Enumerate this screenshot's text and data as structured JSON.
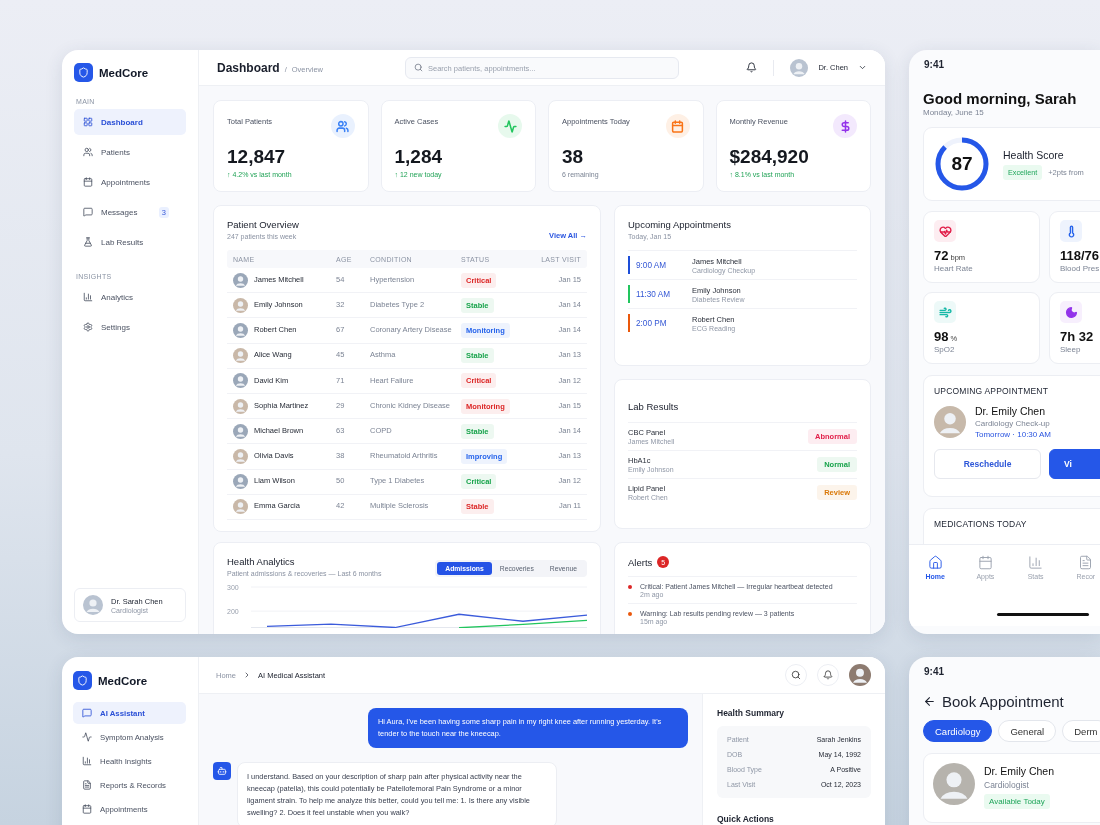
{
  "dashboard": {
    "brand": "MedCore",
    "nav_sections": [
      {
        "heading": "MAIN",
        "items": [
          {
            "label": "Dashboard",
            "selected": true
          },
          {
            "label": "Patients",
            "selected": false
          },
          {
            "label": "Appointments",
            "selected": false
          },
          {
            "label": "Messages",
            "selected": false,
            "badge": "3"
          },
          {
            "label": "Lab Results",
            "selected": false
          }
        ]
      },
      {
        "heading": "INSIGHTS",
        "items": [
          {
            "label": "Analytics",
            "selected": false
          },
          {
            "label": "Settings",
            "selected": false
          }
        ]
      }
    ],
    "user": {
      "name": "Dr. Sarah Chen",
      "role": "Cardiologist"
    },
    "title": "Dashboard",
    "crumb_separator": "/",
    "crumb": "Overview",
    "search_placeholder": "Search patients, appointments...",
    "account": "Dr. Chen",
    "stats": [
      {
        "label": "Total Patients",
        "value": "12,847",
        "note": "↑ 4.2% vs last month",
        "positive": true,
        "color": "#3b82f6"
      },
      {
        "label": "Active Cases",
        "value": "1,284",
        "note": "↑ 12 new today",
        "positive": true,
        "color": "#22c55e"
      },
      {
        "label": "Appointments Today",
        "value": "38",
        "note": "6 remaining",
        "positive": false,
        "color": "#f97316"
      },
      {
        "label": "Monthly Revenue",
        "value": "$284,920",
        "note": "↑ 8.1% vs last month",
        "positive": true,
        "color": "#9333ea"
      }
    ],
    "patients": {
      "title": "Patient Overview",
      "subtitle": "247 patients this week",
      "link": "View All →",
      "columns": [
        "NAME",
        "AGE",
        "CONDITION",
        "STATUS",
        "LAST VISIT"
      ],
      "rows": [
        {
          "name": "James Mitchell",
          "age": "54",
          "condition": "Hypertension",
          "status": "Critical",
          "color": "#dc2626",
          "last_visit": "Jan 15"
        },
        {
          "name": "Emily Johnson",
          "age": "32",
          "condition": "Diabetes Type 2",
          "status": "Stable",
          "color": "#16a34a",
          "last_visit": "Jan 14"
        },
        {
          "name": "Robert Chen",
          "age": "67",
          "condition": "Coronary Artery Disease",
          "status": "Monitoring",
          "color": "#2563eb",
          "last_visit": "Jan 14"
        },
        {
          "name": "Alice Wang",
          "age": "45",
          "condition": "Asthma",
          "status": "Stable",
          "color": "#16a34a",
          "last_visit": "Jan 13"
        },
        {
          "name": "David Kim",
          "age": "71",
          "condition": "Heart Failure",
          "status": "Critical",
          "color": "#dc2626",
          "last_visit": "Jan 12"
        },
        {
          "name": "Sophia Martinez",
          "age": "29",
          "condition": "Chronic Kidney Disease",
          "status": "Monitoring",
          "color": "#dc2626",
          "last_visit": "Jan 15"
        },
        {
          "name": "Michael Brown",
          "age": "63",
          "condition": "COPD",
          "status": "Stable",
          "color": "#16a34a",
          "last_visit": "Jan 14"
        },
        {
          "name": "Olivia Davis",
          "age": "38",
          "condition": "Rheumatoid Arthritis",
          "status": "Improving",
          "color": "#2563eb",
          "last_visit": "Jan 13"
        },
        {
          "name": "Liam Wilson",
          "age": "50",
          "condition": "Type 1 Diabetes",
          "status": "Critical",
          "color": "#16a34a",
          "last_visit": "Jan 12"
        },
        {
          "name": "Emma Garcia",
          "age": "42",
          "condition": "Multiple Sclerosis",
          "status": "Stable",
          "color": "#dc2626",
          "last_visit": "Jan 11"
        }
      ]
    },
    "appointments": {
      "title": "Upcoming Appointments",
      "subtitle": "Today, Jan 15",
      "items": [
        {
          "time": "9:00 AM",
          "name": "James Mitchell",
          "type": "Cardiology Checkup",
          "color": "#1d4ed8"
        },
        {
          "time": "11:30 AM",
          "name": "Emily Johnson",
          "type": "Diabetes Review",
          "color": "#22c55e"
        },
        {
          "time": "2:00 PM",
          "name": "Robert Chen",
          "type": "ECG Reading",
          "color": "#ea580c"
        }
      ]
    },
    "labs": {
      "title": "Lab Results",
      "items": [
        {
          "test": "CBC Panel",
          "patient": "James Mitchell",
          "result": "Abnormal",
          "color": "#e11d48"
        },
        {
          "test": "HbA1c",
          "patient": "Emily Johnson",
          "result": "Normal",
          "color": "#16a34a"
        },
        {
          "test": "Lipid Panel",
          "patient": "Robert Chen",
          "result": "Review",
          "color": "#d97706"
        }
      ]
    },
    "analytics": {
      "title": "Health Analytics",
      "subtitle": "Patient admissions & recoveries — Last 6 months",
      "tabs": [
        {
          "label": "Admissions",
          "selected": true
        },
        {
          "label": "Recoveries",
          "selected": false
        },
        {
          "label": "Revenue",
          "selected": false
        }
      ],
      "chart_data": {
        "type": "line",
        "ylim": [
          130,
          300
        ],
        "yticks": [
          200,
          300
        ],
        "series": [
          {
            "color": "#3b5bdb",
            "values": [
              137,
              146,
              132,
              187,
              158,
              183
            ]
          },
          {
            "color": "#22c55e",
            "values": [
              null,
              null,
              null,
              131,
              145,
              162
            ]
          }
        ]
      }
    },
    "alerts": {
      "title": "Alerts",
      "count": "5",
      "items": [
        {
          "text": "Critical: Patient James Mitchell — Irregular heartbeat detected",
          "time": "2m ago",
          "color": "#dc2626"
        },
        {
          "text": "Warning: Lab results pending review — 3 patients",
          "time": "15m ago",
          "color": "#ea580c"
        }
      ]
    }
  },
  "mobile_home": {
    "time": "9:41",
    "greeting": "Good morning, Sarah",
    "date": "Monday, June 15",
    "score": {
      "value": "87",
      "level": 0.87,
      "title": "Health Score",
      "badge": "Excellent",
      "note": "+2pts from"
    },
    "vitals": [
      {
        "value": "72",
        "unit": "bpm",
        "label": "Heart Rate",
        "color": "#e11d48"
      },
      {
        "value": "118/76",
        "label": "Blood Pres",
        "color": "#2563eb"
      },
      {
        "value": "98",
        "unit": "%",
        "label": "SpO2",
        "color": "#14b8a6"
      },
      {
        "value": "7h 32",
        "label": "Sleep",
        "color": "#9333ea"
      }
    ],
    "appointment": {
      "heading": "UPCOMING APPOINTMENT",
      "doctor": "Dr. Emily Chen",
      "specialty": "Cardiology Check-up",
      "when": "Tomorrow · 10:30 AM",
      "buttons": [
        {
          "label": "Reschedule",
          "primary": false
        },
        {
          "label": "Vi",
          "primary": true
        }
      ]
    },
    "medications_heading": "MEDICATIONS TODAY",
    "nav": [
      {
        "label": "Home",
        "selected": true
      },
      {
        "label": "Appts",
        "selected": false
      },
      {
        "label": "Stats",
        "selected": false
      },
      {
        "label": "Recor",
        "selected": false
      }
    ]
  },
  "assistant": {
    "brand": "MedCore",
    "nav": [
      {
        "label": "AI Assistant",
        "selected": true
      },
      {
        "label": "Symptom Analysis",
        "selected": false
      },
      {
        "label": "Health Insights",
        "selected": false
      },
      {
        "label": "Reports & Records",
        "selected": false
      },
      {
        "label": "Appointments",
        "selected": false
      }
    ],
    "breadcrumb": [
      "Home",
      "AI Medical Assistant"
    ],
    "messages": [
      {
        "kind": "user",
        "text": "Hi Aura, I've been having some sharp pain in my right knee after running yesterday. It's tender to the touch near the kneecap."
      },
      {
        "kind": "bot",
        "text": "I understand. Based on your description of sharp pain after physical activity near the kneecap (patella), this could potentially be Patellofemoral Pain Syndrome or a minor ligament strain. To help me analyze this better, could you tell me: 1. Is there any visible swelling? 2. Does it feel unstable when you walk?"
      }
    ],
    "summary": {
      "title": "Health Summary",
      "rows": [
        {
          "label": "Patient",
          "value": "Sarah Jenkins"
        },
        {
          "label": "DOB",
          "value": "May 14, 1992"
        },
        {
          "label": "Blood Type",
          "value": "A Positive"
        },
        {
          "label": "Last Visit",
          "value": "Oct 12, 2023"
        }
      ]
    },
    "quick_actions_title": "Quick Actions"
  },
  "mobile_booking": {
    "time": "9:41",
    "title": "Book Appointment",
    "chips": [
      {
        "label": "Cardiology",
        "selected": true
      },
      {
        "label": "General",
        "selected": false
      },
      {
        "label": "Derm",
        "selected": false
      }
    ],
    "doctor": {
      "name": "Dr. Emily Chen",
      "role": "Cardiologist",
      "availability": "Available Today"
    }
  }
}
